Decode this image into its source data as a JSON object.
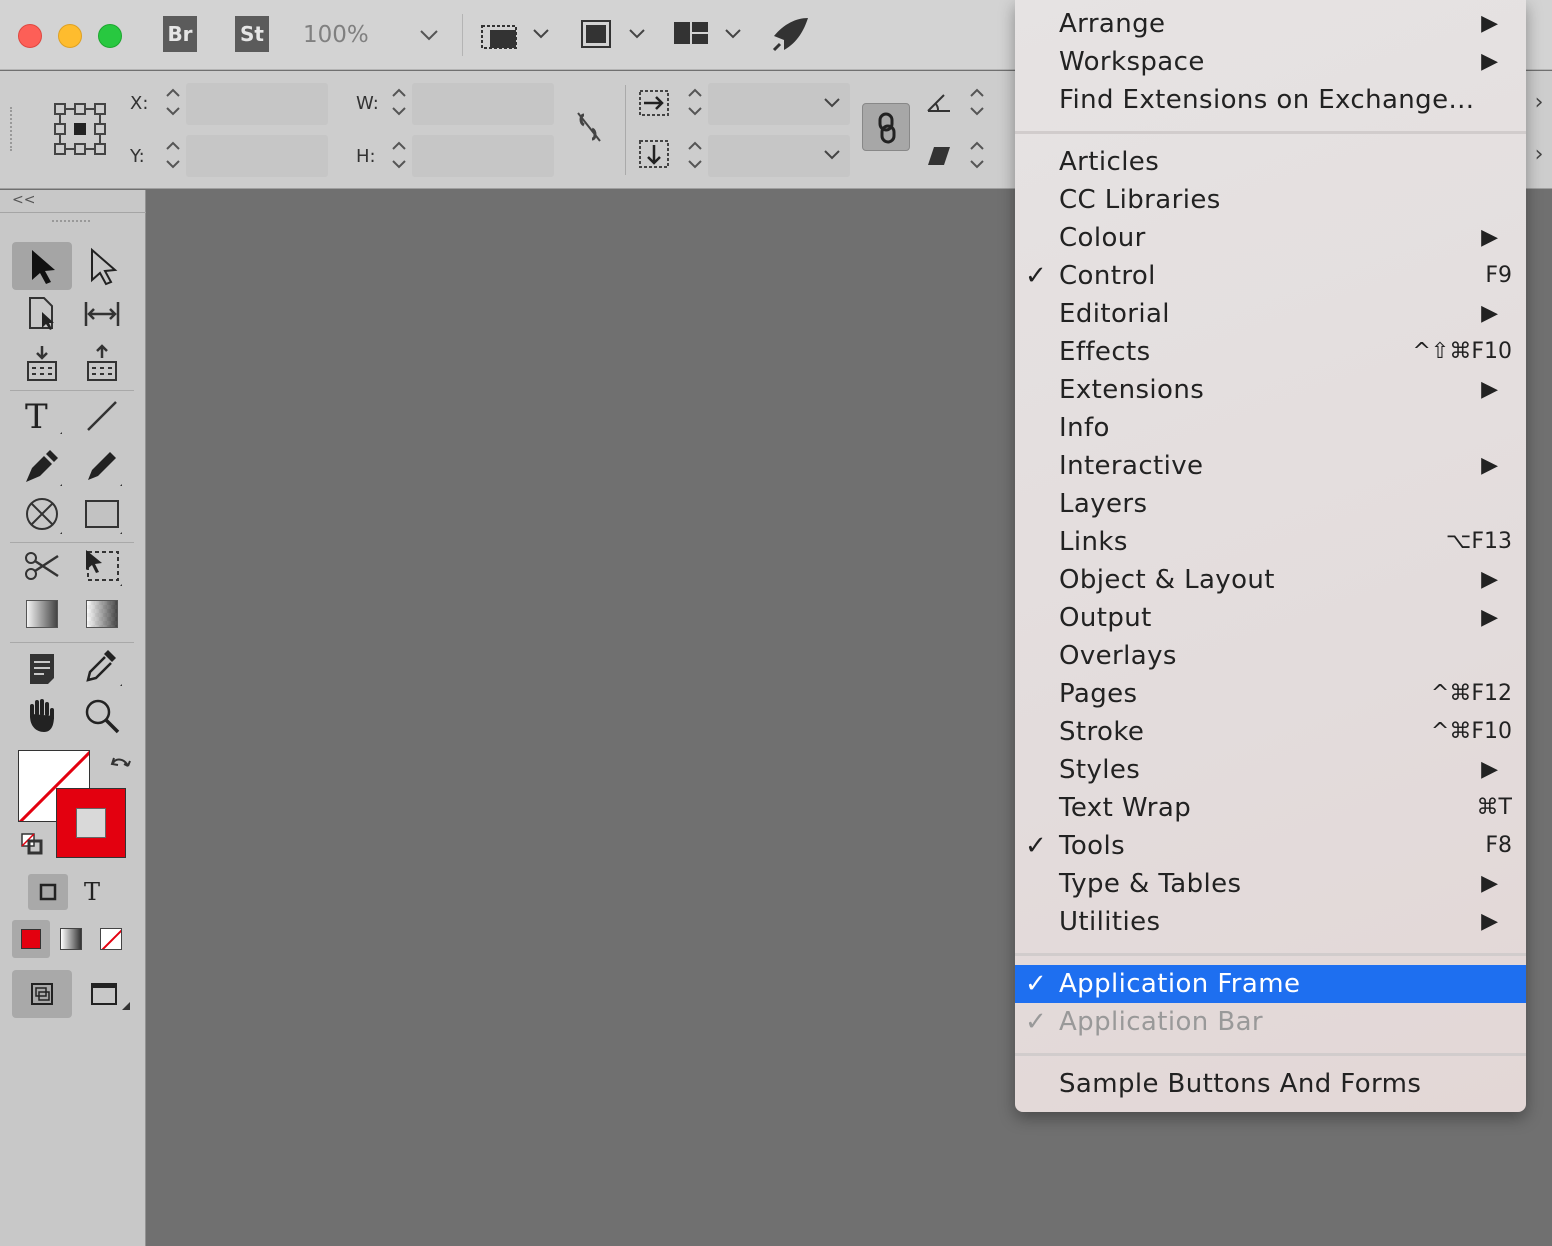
{
  "appbar": {
    "bridge_badge": "Br",
    "stock_badge": "St",
    "zoom": "100%"
  },
  "control": {
    "x_label": "X:",
    "y_label": "Y:",
    "w_label": "W:",
    "h_label": "H:"
  },
  "menu": {
    "items": [
      {
        "label": "Arrange",
        "submenu": true
      },
      {
        "label": "Workspace",
        "submenu": true
      },
      {
        "label": "Find Extensions on Exchange..."
      },
      {
        "label": "Articles"
      },
      {
        "label": "CC Libraries"
      },
      {
        "label": "Colour",
        "submenu": true
      },
      {
        "label": "Control",
        "checked": true,
        "shortcut": "F9"
      },
      {
        "label": "Editorial",
        "submenu": true
      },
      {
        "label": "Effects",
        "shortcut": "^⇧⌘F10"
      },
      {
        "label": "Extensions",
        "submenu": true
      },
      {
        "label": "Info"
      },
      {
        "label": "Interactive",
        "submenu": true
      },
      {
        "label": "Layers"
      },
      {
        "label": "Links",
        "shortcut": "⌥F13"
      },
      {
        "label": "Object & Layout",
        "submenu": true
      },
      {
        "label": "Output",
        "submenu": true
      },
      {
        "label": "Overlays"
      },
      {
        "label": "Pages",
        "shortcut": "^⌘F12"
      },
      {
        "label": "Stroke",
        "shortcut": "^⌘F10"
      },
      {
        "label": "Styles",
        "submenu": true
      },
      {
        "label": "Text Wrap",
        "shortcut": "⌘T"
      },
      {
        "label": "Tools",
        "checked": true,
        "shortcut": "F8"
      },
      {
        "label": "Type & Tables",
        "submenu": true
      },
      {
        "label": "Utilities",
        "submenu": true
      },
      {
        "label": "Application Frame",
        "checked": true,
        "selected": true
      },
      {
        "label": "Application Bar",
        "checked": true,
        "disabled": true
      },
      {
        "label": "Sample Buttons And Forms"
      }
    ],
    "submenu_arrow": "▶",
    "check_mark": "✓",
    "highlight_color": "#1e6ff0"
  },
  "tools": {
    "collapse_label": "<<",
    "fill_color": "#ffffff",
    "stroke_color": "#e3000f"
  },
  "edge": {
    "chevron": "›"
  }
}
